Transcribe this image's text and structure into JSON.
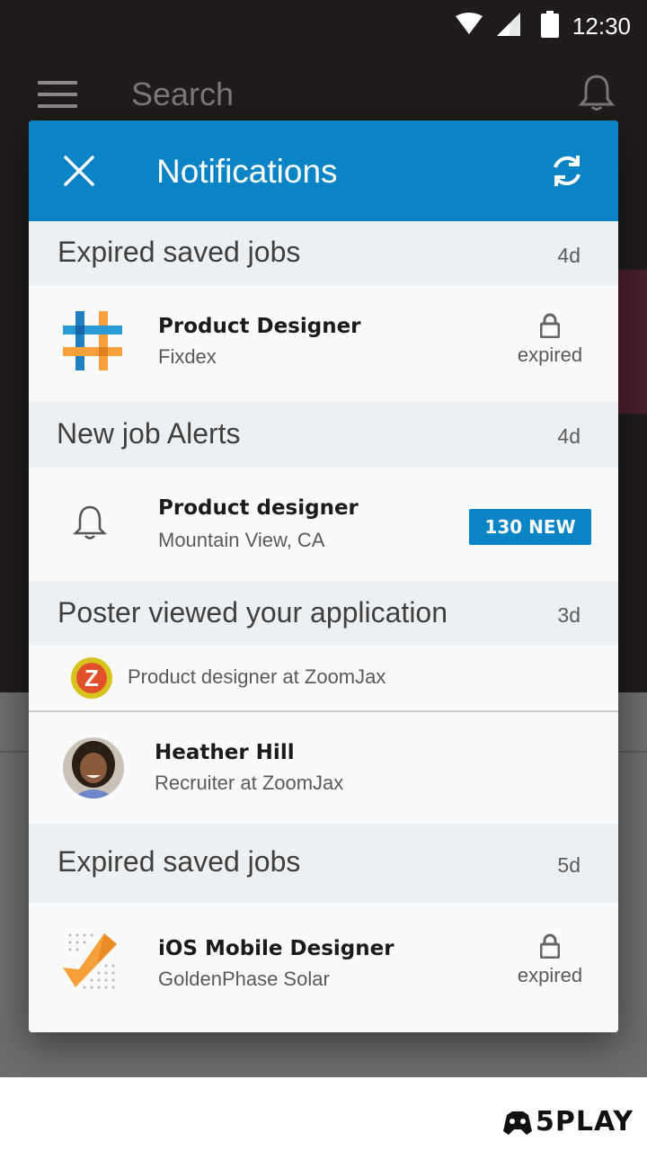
{
  "status_bar": {
    "time": "12:30"
  },
  "app_bar": {
    "search_placeholder": "Search"
  },
  "dialog": {
    "title": "Notifications",
    "sections": [
      {
        "heading": "Expired saved jobs",
        "age": "4d",
        "item": {
          "title": "Product Designer",
          "subtitle": "Fixdex",
          "status": "expired"
        }
      },
      {
        "heading": "New job Alerts",
        "age": "4d",
        "item": {
          "title": "Product designer",
          "subtitle": "Mountain View, CA",
          "badge": "130 NEW"
        }
      },
      {
        "heading": "Poster viewed your application",
        "age": "3d",
        "company_line": "Product designer at ZoomJax",
        "item": {
          "title": "Heather Hill",
          "subtitle": "Recruiter at ZoomJax"
        }
      },
      {
        "heading": "Expired saved jobs",
        "age": "5d",
        "item": {
          "title": "iOS Mobile Designer",
          "subtitle": "GoldenPhase Solar",
          "status": "expired"
        }
      }
    ]
  },
  "watermark": {
    "text": "5PLAY"
  },
  "colors": {
    "accent": "#0a84c4",
    "section_bg": "#edf0f3",
    "row_bg": "#f9fafb"
  },
  "icons": [
    "close-icon",
    "refresh-icon",
    "lock-icon",
    "bell-icon",
    "menu-icon",
    "wifi-icon",
    "signal-icon",
    "battery-icon"
  ]
}
